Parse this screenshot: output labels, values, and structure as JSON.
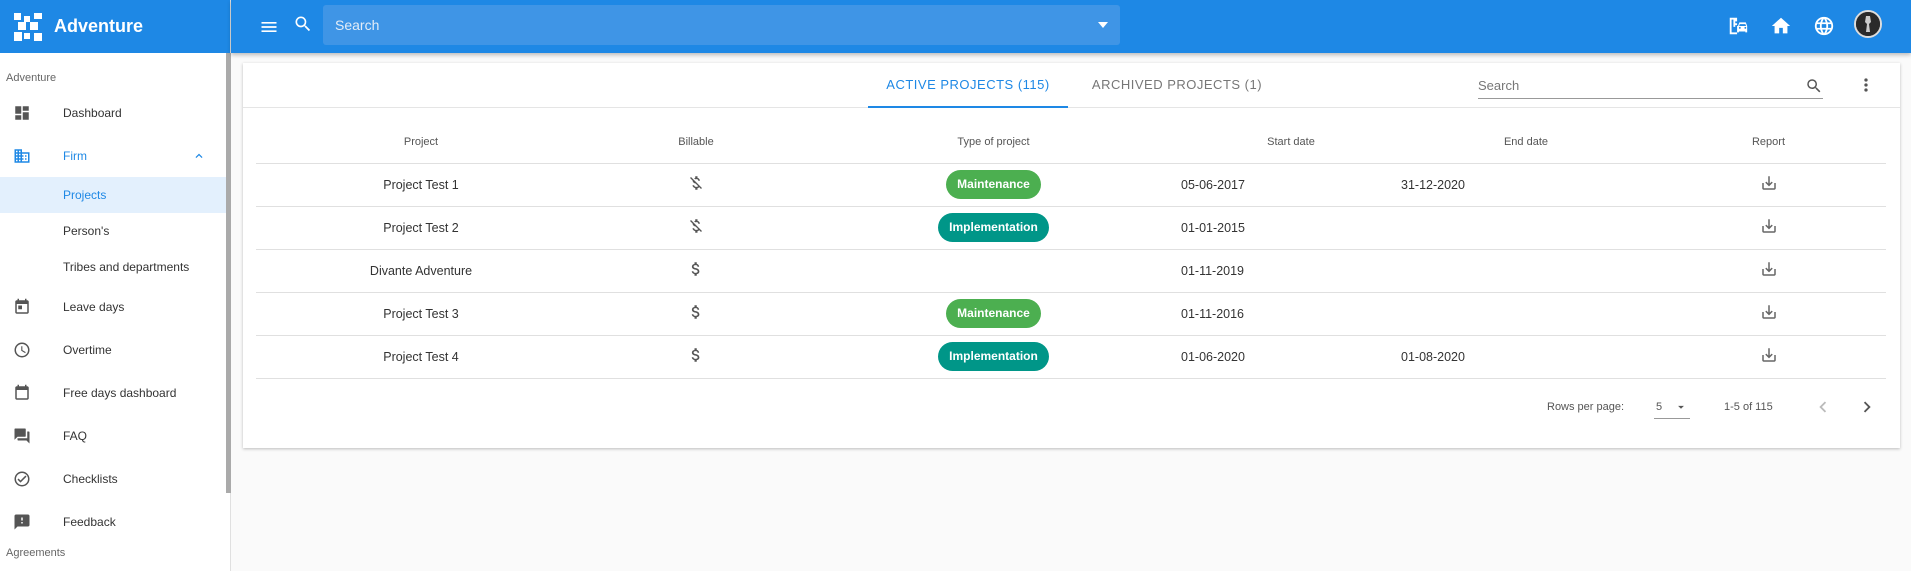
{
  "app": {
    "name": "Adventure"
  },
  "topbar": {
    "search_placeholder": "Search"
  },
  "sidebar": {
    "section_top": "Adventure",
    "items": {
      "dashboard": "Dashboard",
      "firm": "Firm",
      "projects": "Projects",
      "persons": "Person's",
      "tribes": "Tribes and departments",
      "leave": "Leave days",
      "overtime": "Overtime",
      "free_days": "Free days dashboard",
      "faq": "FAQ",
      "checklists": "Checklists",
      "feedback": "Feedback"
    },
    "section_bottom": "Agreements"
  },
  "tabs": {
    "active": "ACTIVE PROJECTS (115)",
    "archived": "ARCHIVED PROJECTS (1)"
  },
  "card_search": {
    "placeholder": "Search"
  },
  "table": {
    "headers": {
      "project": "Project",
      "billable": "Billable",
      "type": "Type of project",
      "start": "Start date",
      "end": "End date",
      "report": "Report"
    },
    "rows": [
      {
        "project": "Project Test 1",
        "billable": false,
        "type": "Maintenance",
        "start": "05-06-2017",
        "end": "31-12-2020"
      },
      {
        "project": "Project Test 2",
        "billable": false,
        "type": "Implementation",
        "start": "01-01-2015",
        "end": ""
      },
      {
        "project": "Divante Adventure",
        "billable": true,
        "type": "",
        "start": "01-11-2019",
        "end": ""
      },
      {
        "project": "Project Test 3",
        "billable": true,
        "type": "Maintenance",
        "start": "01-11-2016",
        "end": ""
      },
      {
        "project": "Project Test 4",
        "billable": true,
        "type": "Implementation",
        "start": "01-06-2020",
        "end": "01-08-2020"
      }
    ]
  },
  "pager": {
    "rows_per_page_label": "Rows per page:",
    "rows_per_page": "5",
    "range": "1-5 of 115"
  },
  "colors": {
    "primary": "#1e88e5",
    "maintenance": "#4caf50",
    "implementation": "#009688"
  }
}
